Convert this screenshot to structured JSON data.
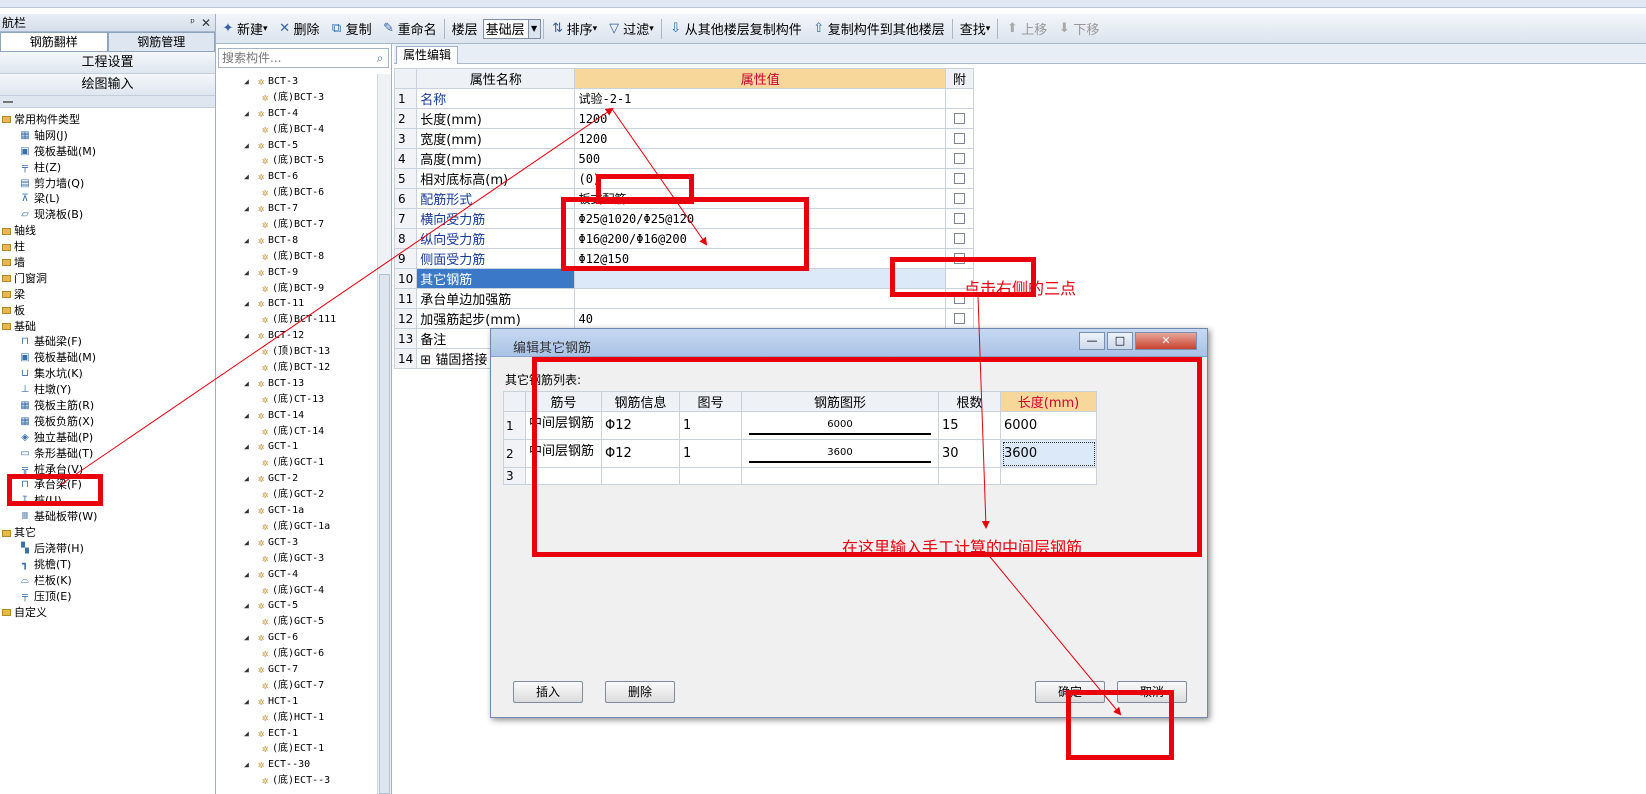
{
  "toolbar": {
    "new_label": "新建",
    "delete_label": "删除",
    "copy_label": "复制",
    "rename_label": "重命名",
    "floor_label": "楼层",
    "floor_value": "基础层",
    "sort_label": "排序",
    "filter_label": "过滤",
    "copy_from_label": "从其他楼层复制构件",
    "copy_to_label": "复制构件到其他楼层",
    "find_label": "查找",
    "up_label": "上移",
    "down_label": "下移"
  },
  "nav": {
    "title": "航栏",
    "tabs": [
      "钢筋翻样",
      "钢筋管理"
    ],
    "buttons": [
      "工程设置",
      "绘图输入"
    ],
    "tree": [
      {
        "type": "folder",
        "label": "常用构件类型",
        "indent": 0
      },
      {
        "type": "item",
        "label": "轴网(J)",
        "icon": "grid-icon",
        "glyph": "▦",
        "indent": 1
      },
      {
        "type": "item",
        "label": "筏板基础(M)",
        "icon": "raft-foundation-icon",
        "glyph": "▣",
        "indent": 1
      },
      {
        "type": "item",
        "label": "柱(Z)",
        "icon": "column-icon",
        "glyph": "╤",
        "indent": 1
      },
      {
        "type": "item",
        "label": "剪力墙(Q)",
        "icon": "shear-wall-icon",
        "glyph": "▤",
        "indent": 1
      },
      {
        "type": "item",
        "label": "梁(L)",
        "icon": "beam-icon",
        "glyph": "⊼",
        "indent": 1
      },
      {
        "type": "item",
        "label": "现浇板(B)",
        "icon": "slab-icon",
        "glyph": "▱",
        "indent": 1
      },
      {
        "type": "folder",
        "label": "轴线",
        "indent": 0
      },
      {
        "type": "folder",
        "label": "柱",
        "indent": 0
      },
      {
        "type": "folder",
        "label": "墙",
        "indent": 0
      },
      {
        "type": "folder",
        "label": "门窗洞",
        "indent": 0
      },
      {
        "type": "folder",
        "label": "梁",
        "indent": 0
      },
      {
        "type": "folder",
        "label": "板",
        "indent": 0
      },
      {
        "type": "folder",
        "label": "基础",
        "indent": 0
      },
      {
        "type": "item",
        "label": "基础梁(F)",
        "icon": "foundation-beam-icon",
        "glyph": "⊓",
        "indent": 1
      },
      {
        "type": "item",
        "label": "筏板基础(M)",
        "icon": "raft-foundation-icon",
        "glyph": "▣",
        "indent": 1
      },
      {
        "type": "item",
        "label": "集水坑(K)",
        "icon": "sump-pit-icon",
        "glyph": "⊔",
        "indent": 1
      },
      {
        "type": "item",
        "label": "柱墩(Y)",
        "icon": "column-pier-icon",
        "glyph": "⊥",
        "indent": 1
      },
      {
        "type": "item",
        "label": "筏板主筋(R)",
        "icon": "raft-main-rebar-icon",
        "glyph": "▦",
        "indent": 1
      },
      {
        "type": "item",
        "label": "筏板负筋(X)",
        "icon": "raft-negative-rebar-icon",
        "glyph": "▦",
        "indent": 1
      },
      {
        "type": "item",
        "label": "独立基础(P)",
        "icon": "isolated-footing-icon",
        "glyph": "◈",
        "indent": 1
      },
      {
        "type": "item",
        "label": "条形基础(T)",
        "icon": "strip-footing-icon",
        "glyph": "▭",
        "indent": 1
      },
      {
        "type": "item",
        "label": "桩承台(V)",
        "icon": "pile-cap-icon",
        "glyph": "╦",
        "indent": 1
      },
      {
        "type": "item",
        "label": "承台梁(F)",
        "icon": "cap-beam-icon",
        "glyph": "⊓",
        "indent": 1
      },
      {
        "type": "item",
        "label": "桩(U)",
        "icon": "pile-icon",
        "glyph": "↧",
        "indent": 1
      },
      {
        "type": "item",
        "label": "基础板带(W)",
        "icon": "foundation-strip-icon",
        "glyph": "Ⅲ",
        "indent": 1
      },
      {
        "type": "folder",
        "label": "其它",
        "indent": 0
      },
      {
        "type": "item",
        "label": "后浇带(H)",
        "icon": "post-cast-strip-icon",
        "glyph": "▚",
        "indent": 1
      },
      {
        "type": "item",
        "label": "挑檐(T)",
        "icon": "eave-icon",
        "glyph": "┓",
        "indent": 1
      },
      {
        "type": "item",
        "label": "栏板(K)",
        "icon": "parapet-icon",
        "glyph": "⌓",
        "indent": 1
      },
      {
        "type": "item",
        "label": "压顶(E)",
        "icon": "coping-icon",
        "glyph": "╤",
        "indent": 1
      },
      {
        "type": "folder",
        "label": "自定义",
        "indent": 0
      }
    ]
  },
  "components": {
    "search_placeholder": "搜索构件...",
    "items": [
      {
        "label": "BCT-3",
        "level": 0
      },
      {
        "label": "(底)BCT-3",
        "level": 1
      },
      {
        "label": "BCT-4",
        "level": 0
      },
      {
        "label": "(底)BCT-4",
        "level": 1
      },
      {
        "label": "BCT-5",
        "level": 0
      },
      {
        "label": "(底)BCT-5",
        "level": 1
      },
      {
        "label": "BCT-6",
        "level": 0
      },
      {
        "label": "(底)BCT-6",
        "level": 1
      },
      {
        "label": "BCT-7",
        "level": 0
      },
      {
        "label": "(底)BCT-7",
        "level": 1
      },
      {
        "label": "BCT-8",
        "level": 0
      },
      {
        "label": "(底)BCT-8",
        "level": 1
      },
      {
        "label": "BCT-9",
        "level": 0
      },
      {
        "label": "(底)BCT-9",
        "level": 1
      },
      {
        "label": "BCT-11",
        "level": 0
      },
      {
        "label": "(底)BCT-111",
        "level": 1
      },
      {
        "label": "BCT-12",
        "level": 0
      },
      {
        "label": "(顶)BCT-13",
        "level": 1
      },
      {
        "label": "(底)BCT-12",
        "level": 1
      },
      {
        "label": "BCT-13",
        "level": 0
      },
      {
        "label": "(底)CT-13",
        "level": 1
      },
      {
        "label": "BCT-14",
        "level": 0
      },
      {
        "label": "(底)CT-14",
        "level": 1
      },
      {
        "label": "GCT-1",
        "level": 0
      },
      {
        "label": "(底)GCT-1",
        "level": 1
      },
      {
        "label": "GCT-2",
        "level": 0
      },
      {
        "label": "(底)GCT-2",
        "level": 1
      },
      {
        "label": "GCT-1a",
        "level": 0
      },
      {
        "label": "(底)GCT-1a",
        "level": 1
      },
      {
        "label": "GCT-3",
        "level": 0
      },
      {
        "label": "(底)GCT-3",
        "level": 1
      },
      {
        "label": "GCT-4",
        "level": 0
      },
      {
        "label": "(底)GCT-4",
        "level": 1
      },
      {
        "label": "GCT-5",
        "level": 0
      },
      {
        "label": "(底)GCT-5",
        "level": 1
      },
      {
        "label": "GCT-6",
        "level": 0
      },
      {
        "label": "(底)GCT-6",
        "level": 1
      },
      {
        "label": "GCT-7",
        "level": 0
      },
      {
        "label": "(底)GCT-7",
        "level": 1
      },
      {
        "label": "HCT-1",
        "level": 0
      },
      {
        "label": "(底)HCT-1",
        "level": 1
      },
      {
        "label": "ECT-1",
        "level": 0
      },
      {
        "label": "(底)ECT-1",
        "level": 1
      },
      {
        "label": "ECT--30",
        "level": 0
      },
      {
        "label": "(底)ECT--3",
        "level": 1
      }
    ]
  },
  "properties": {
    "tab_label": "属性编辑",
    "headers": {
      "name": "属性名称",
      "value": "属性值",
      "attach": "附"
    },
    "rows": [
      {
        "num": "1",
        "name": "名称",
        "value": "试验-2-1",
        "blue": true,
        "checkbox": false
      },
      {
        "num": "2",
        "name": "长度(mm)",
        "value": "1200",
        "blue": false,
        "checkbox": true
      },
      {
        "num": "3",
        "name": "宽度(mm)",
        "value": "1200",
        "blue": false,
        "checkbox": true
      },
      {
        "num": "4",
        "name": "高度(mm)",
        "value": "500",
        "blue": false,
        "checkbox": true
      },
      {
        "num": "5",
        "name": "相对底标高(m)",
        "value": "(0)",
        "blue": false,
        "checkbox": true
      },
      {
        "num": "6",
        "name": "配筋形式",
        "value": "板式配筋",
        "blue": true,
        "checkbox": true
      },
      {
        "num": "7",
        "name": "横向受力筋",
        "value": "Φ25@1020/Φ25@120",
        "blue": true,
        "checkbox": true
      },
      {
        "num": "8",
        "name": "纵向受力筋",
        "value": "Φ16@200/Φ16@200",
        "blue": true,
        "checkbox": true
      },
      {
        "num": "9",
        "name": "侧面受力筋",
        "value": "Φ12@150",
        "blue": true,
        "checkbox": true
      },
      {
        "num": "10",
        "name": "其它钢筋",
        "value": "",
        "blue": false,
        "checkbox": false,
        "selected": true
      },
      {
        "num": "11",
        "name": "承台单边加强筋",
        "value": "",
        "blue": false,
        "checkbox": true
      },
      {
        "num": "12",
        "name": "加强筋起步(mm)",
        "value": "40",
        "blue": false,
        "checkbox": true
      },
      {
        "num": "13",
        "name": "备注",
        "value": "",
        "blue": false,
        "checkbox": true
      },
      {
        "num": "14",
        "name": "⊞ 锚固搭接",
        "value": "",
        "blue": false,
        "checkbox": false
      }
    ]
  },
  "dialog": {
    "title": "编辑其它钢筋",
    "list_label": "其它钢筋列表:",
    "headers": [
      "筋号",
      "钢筋信息",
      "图号",
      "钢筋图形",
      "根数",
      "长度(mm)"
    ],
    "rows": [
      {
        "num": "1",
        "name": "中间层钢筋",
        "info": "Φ12",
        "fig": "1",
        "shape": "6000",
        "count": "15",
        "length": "6000"
      },
      {
        "num": "2",
        "name": "中间层钢筋",
        "info": "Φ12",
        "fig": "1",
        "shape": "3600",
        "count": "30",
        "length": "3600"
      },
      {
        "num": "3",
        "name": "",
        "info": "",
        "fig": "",
        "shape": "",
        "count": "",
        "length": ""
      }
    ],
    "insert_label": "插入",
    "delete_label": "删除",
    "ok_label": "确定",
    "cancel_label": "取消",
    "min_label": "—",
    "max_label": "□",
    "close_label": "✕"
  },
  "annotations": {
    "click_three_dots": "点击右侧的三点",
    "enter_here": "在这里输入手工计算的中间层钢筋",
    "color": "#e8000d"
  }
}
